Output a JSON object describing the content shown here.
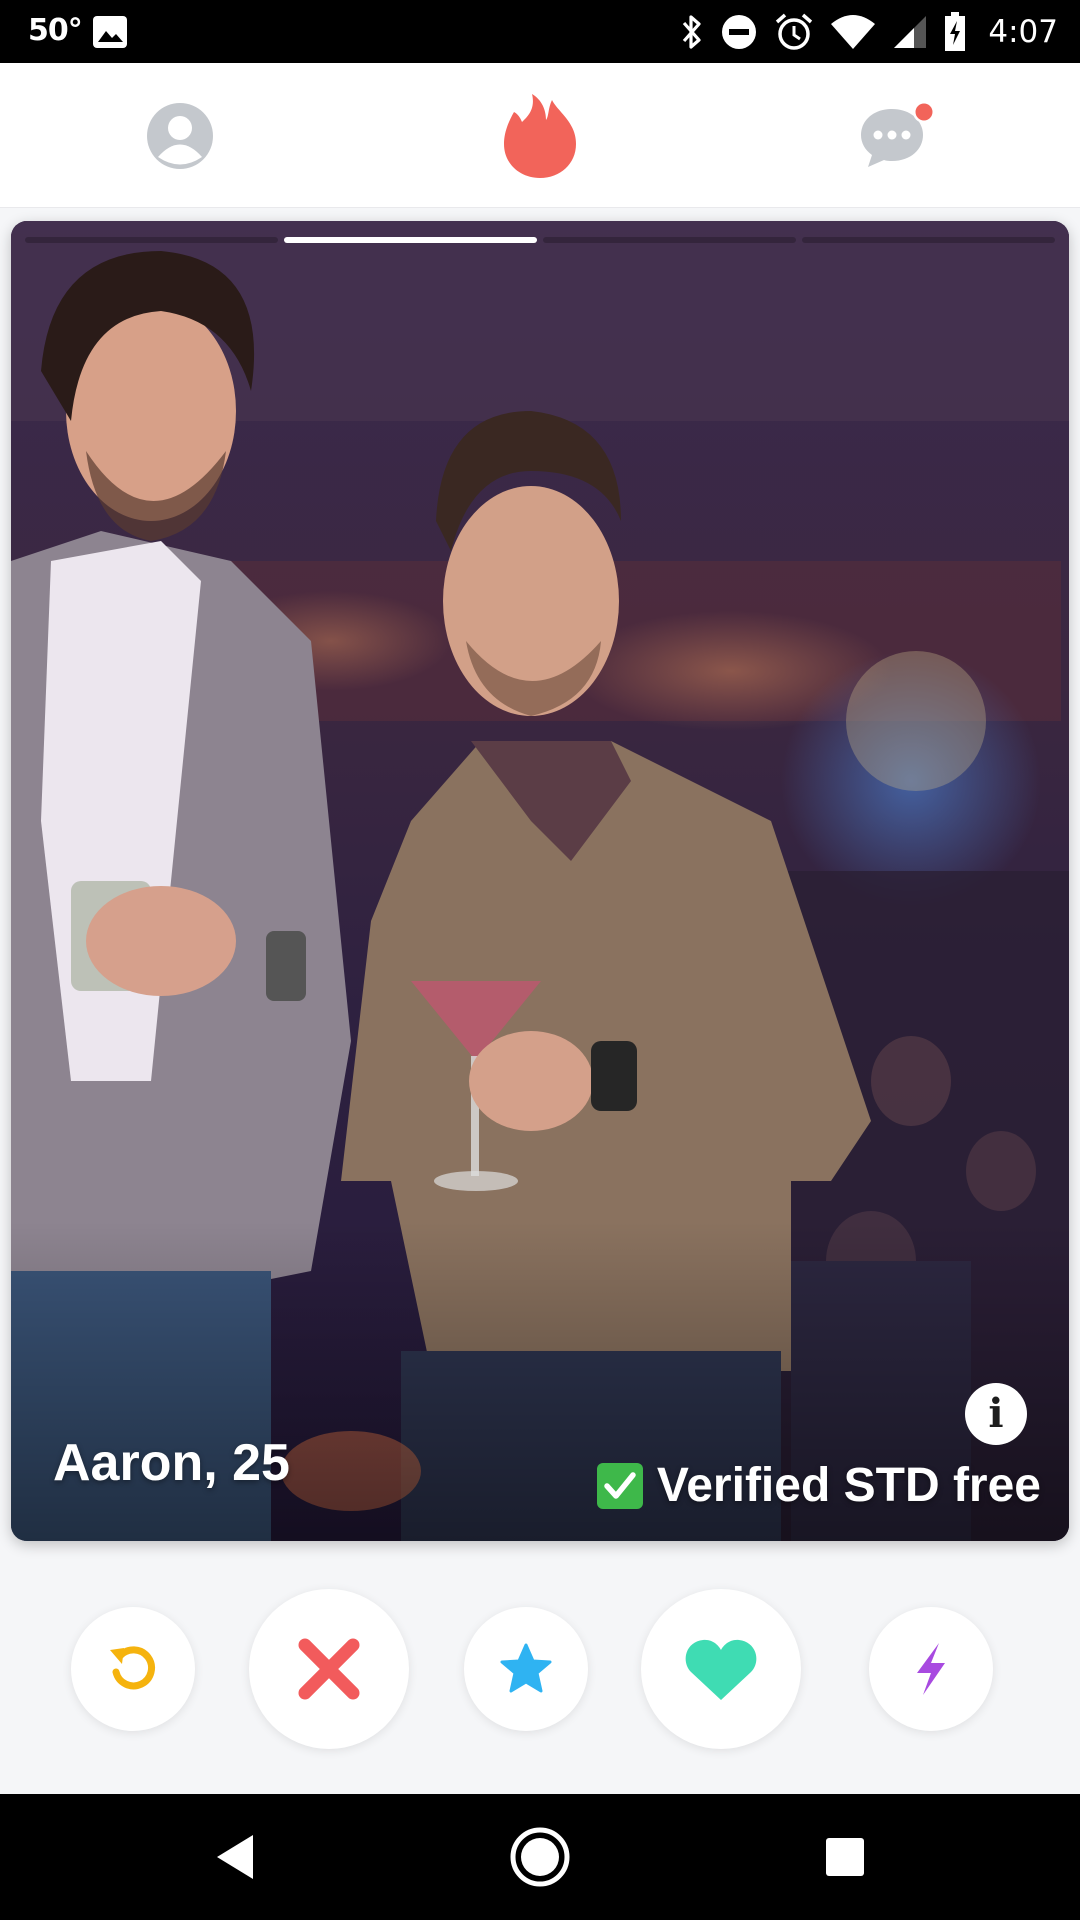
{
  "status_bar": {
    "temperature": "50°",
    "time": "4:07",
    "icons": [
      "image-icon",
      "bluetooth-icon",
      "do-not-disturb-icon",
      "alarm-icon",
      "wifi-icon",
      "signal-icon",
      "battery-charging-icon"
    ]
  },
  "header": {
    "icons": [
      "profile-icon",
      "tinder-flame-icon",
      "messages-icon"
    ],
    "brand_color": "#f2645a",
    "messages_has_notification": true
  },
  "card": {
    "name_age": "Aaron, 25",
    "verified_text": "Verified STD free",
    "photo_count": 4,
    "active_photo_index": 2,
    "photo_description_icons": [
      "photo",
      "info-icon",
      "check-mark-icon"
    ]
  },
  "actions": [
    {
      "icon": "rewind-icon",
      "color": "#f5b30e"
    },
    {
      "icon": "nope-x-icon",
      "color": "#f25b5c"
    },
    {
      "icon": "super-like-star-icon",
      "color": "#2fb3f2"
    },
    {
      "icon": "like-heart-icon",
      "color": "#3fdcb3"
    },
    {
      "icon": "boost-bolt-icon",
      "color": "#a84ae0"
    }
  ],
  "nav_bar": {
    "icons": [
      "back-icon",
      "home-icon",
      "recents-icon"
    ]
  }
}
